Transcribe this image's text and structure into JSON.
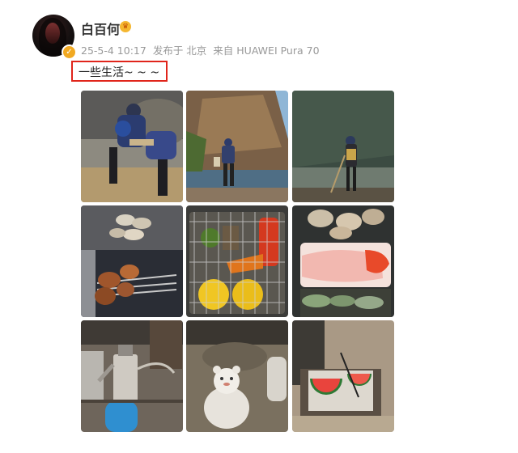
{
  "post": {
    "username": "白百何",
    "date": "25-5-4 10:17",
    "location": "发布于 北京",
    "device": "来自 HUAWEI Pura 70",
    "text": "一些生活~ ~ ~"
  },
  "photos": [
    {
      "subject": "people-digging-by-rocks"
    },
    {
      "subject": "person-at-river-cliff"
    },
    {
      "subject": "person-with-stick-by-river"
    },
    {
      "subject": "grilled-skewers"
    },
    {
      "subject": "grill-basket-fruit"
    },
    {
      "subject": "seafood-platter"
    },
    {
      "subject": "camping-kettle-stove"
    },
    {
      "subject": "figure-in-sand"
    },
    {
      "subject": "watermelon-slices"
    }
  ],
  "colors": {
    "highlight_box": "#e0251b",
    "meta_text": "#999999",
    "badge": "#f1a922"
  }
}
